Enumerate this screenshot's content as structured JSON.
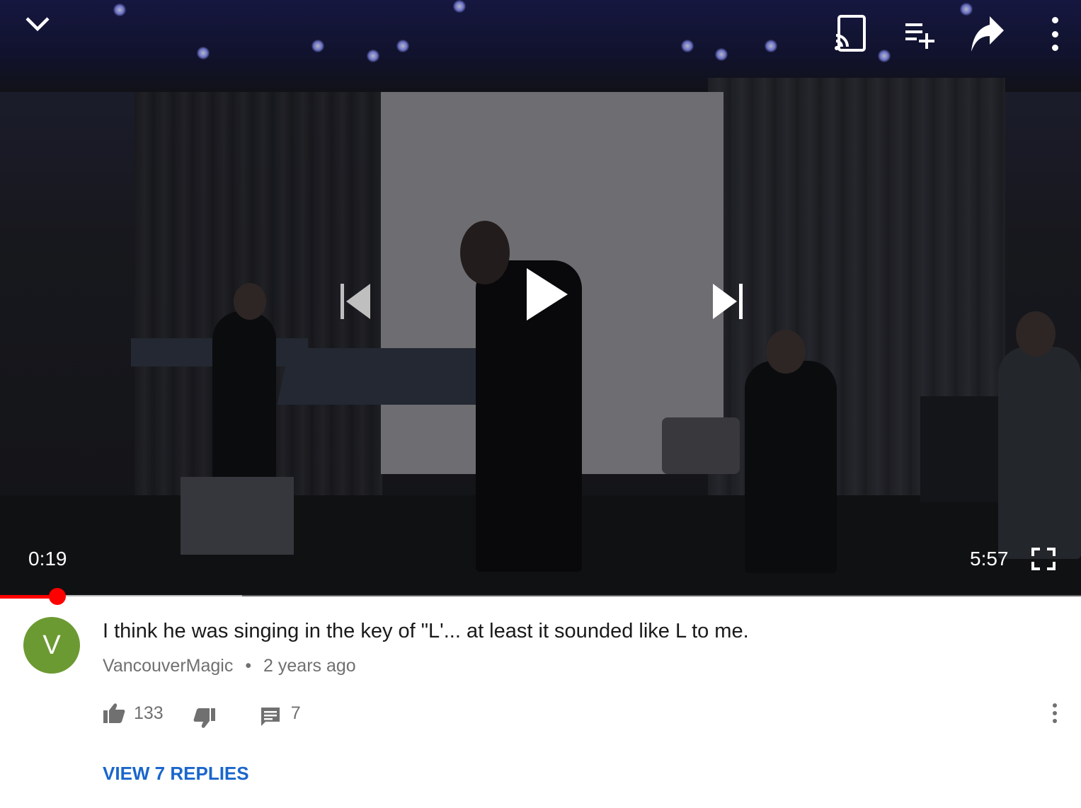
{
  "player": {
    "current_time": "0:19",
    "duration": "5:57",
    "progress_fraction": 0.053,
    "buffered_fraction": 0.224,
    "top_icons": [
      "chevron-down-icon",
      "cast-icon",
      "add-to-queue-icon",
      "share-icon",
      "more-vert-icon"
    ],
    "center_icons": [
      "previous-icon",
      "play-icon",
      "next-icon"
    ],
    "accent_color": "#ff0000"
  },
  "comment": {
    "avatar_letter": "V",
    "avatar_color": "#6c9a32",
    "text": "I think he was singing in the key of \"L'... at least it sounded like L to me.",
    "author": "VancouverMagic",
    "separator": "•",
    "time_ago": "2 years ago",
    "likes": "133",
    "replies_count": "7",
    "view_replies": "VIEW 7 REPLIES",
    "link_color": "#1a66cc"
  }
}
